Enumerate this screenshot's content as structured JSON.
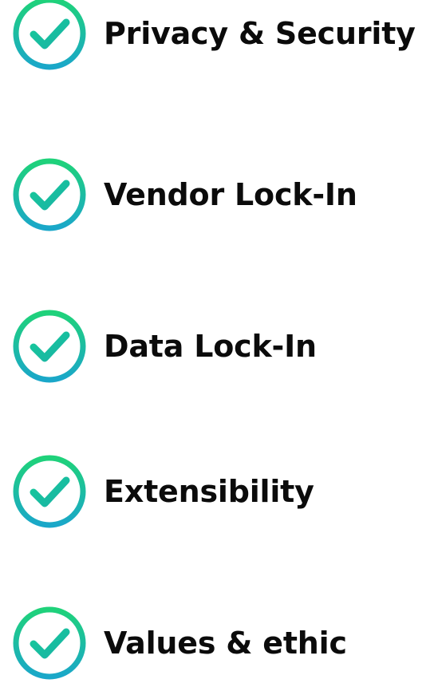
{
  "colors": {
    "gradient_top": "#1fd27a",
    "gradient_bottom": "#1aa7c9",
    "text": "#0b0b0b",
    "background": "#ffffff"
  },
  "items": [
    {
      "label": "Privacy & Security",
      "icon": "check-circle-icon"
    },
    {
      "label": "Vendor Lock-In",
      "icon": "check-circle-icon"
    },
    {
      "label": "Data Lock-In",
      "icon": "check-circle-icon"
    },
    {
      "label": "Extensibility",
      "icon": "check-circle-icon"
    },
    {
      "label": "Values & ethic",
      "icon": "check-circle-icon"
    }
  ]
}
